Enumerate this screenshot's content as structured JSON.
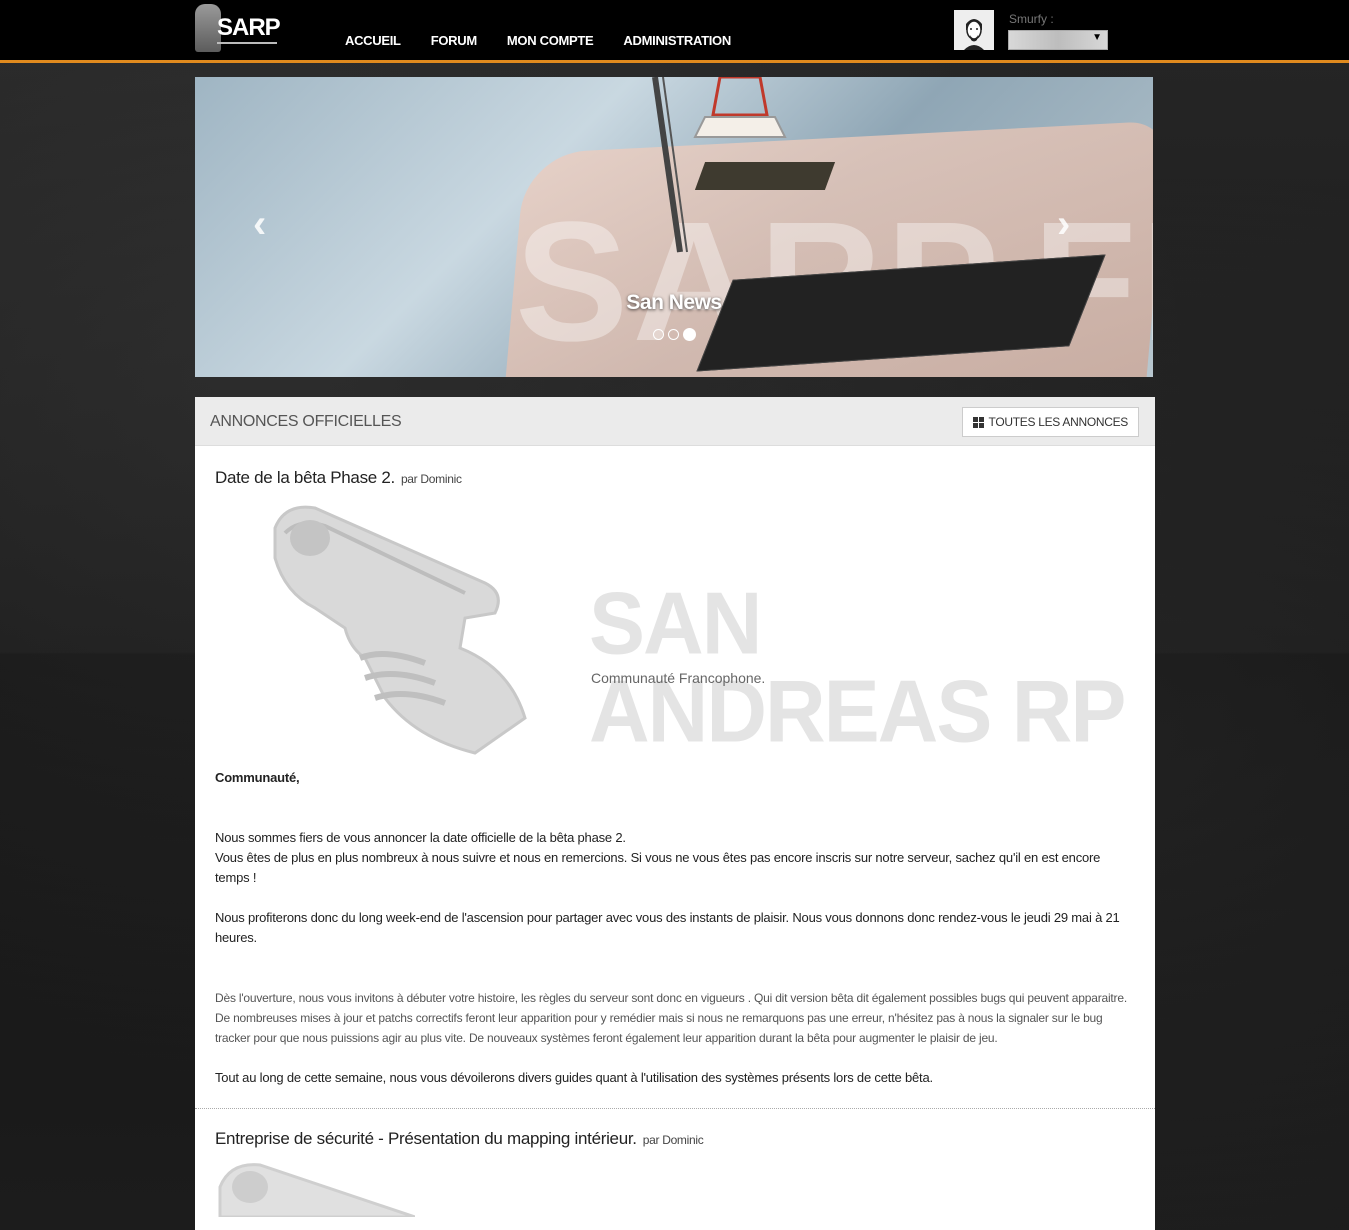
{
  "header": {
    "logo_text": "SARP",
    "nav": [
      "ACCUEIL",
      "FORUM",
      "MON COMPTE",
      "ADMINISTRATION"
    ],
    "username_label": "Smurfy :",
    "accent_color": "#e08a1e"
  },
  "carousel": {
    "caption": "San News",
    "watermark": "SARP.FR",
    "slide_count": 3,
    "active_slide": 3,
    "prev_icon": "chevron-left-icon",
    "next_icon": "chevron-right-icon"
  },
  "panel": {
    "title": "ANNONCES OFFICIELLES",
    "all_button": "TOUTES LES ANNONCES"
  },
  "articles": [
    {
      "title": "Date de la bêta Phase 2.",
      "author": "par Dominic",
      "banner_title": "SAN ANDREAS RP",
      "banner_subtitle": "Communauté Francophone.",
      "greeting": "Communauté,",
      "p1a": "Nous sommes fiers de vous annoncer la date officielle de la bêta phase 2.",
      "p1b": "Vous êtes de plus en plus nombreux à nous suivre et nous en remercions. Si vous ne vous êtes pas encore inscris sur notre serveur, sachez qu'il en est encore temps !",
      "p2": "Nous profiterons donc du long week-end de l'ascension pour partager avec vous des instants de plaisir. Nous vous donnons donc rendez-vous le jeudi 29 mai à 21 heures.",
      "p3": "Dès l'ouverture, nous vous invitons à débuter votre histoire, les règles du serveur sont donc en vigueurs . Qui dit version bêta dit également possibles bugs qui peuvent apparaitre. De nombreuses mises à jour et patchs correctifs feront leur apparition pour y remédier mais si nous ne remarquons pas une erreur, n'hésitez pas à nous la signaler sur le bug tracker pour que nous puissions agir au plus vite. De nouveaux systèmes feront également leur apparition durant la bêta pour augmenter le plaisir de jeu.",
      "p4": "Tout au long de cette semaine, nous vous dévoilerons divers guides quant à l'utilisation des systèmes présents lors de cette bêta."
    },
    {
      "title": "Entreprise de sécurité - Présentation du mapping intérieur.",
      "author": "par Dominic"
    }
  ]
}
